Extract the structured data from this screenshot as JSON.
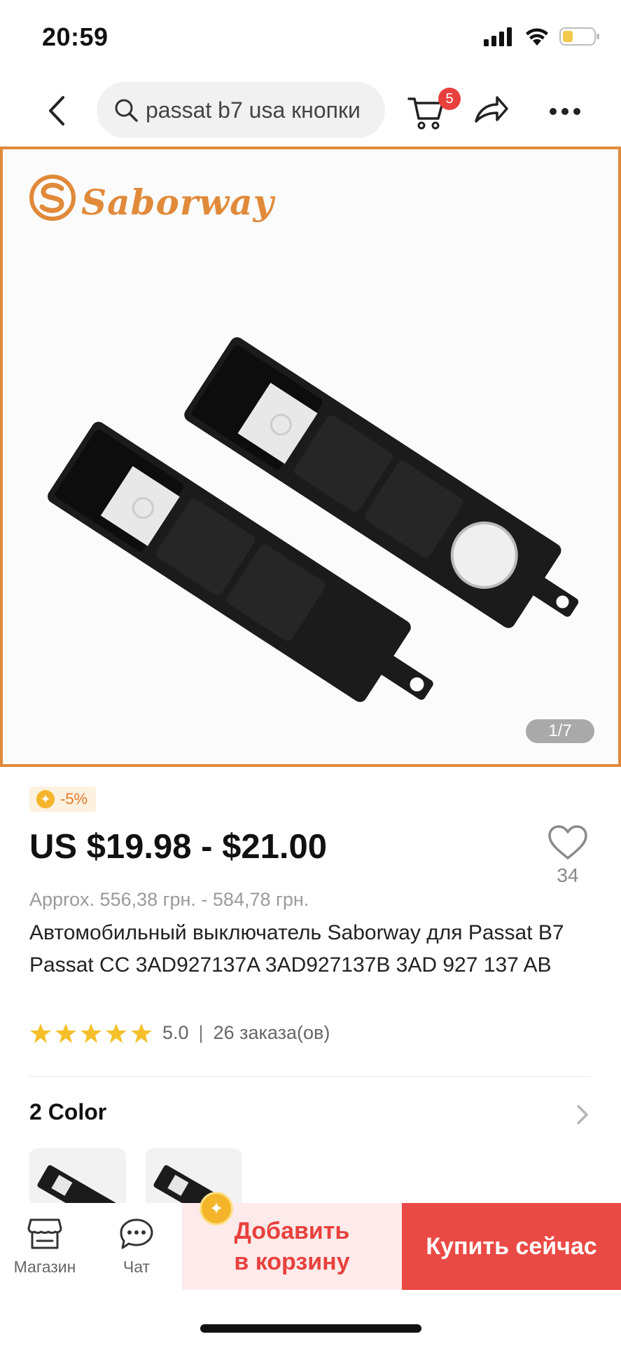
{
  "status_bar": {
    "time": "20:59"
  },
  "header": {
    "search_value": "passat b7 usa кнопки",
    "cart_count": "5"
  },
  "gallery": {
    "brand_logo": "Saborway",
    "counter": "1/7",
    "accent_color": "#e08a3a"
  },
  "product": {
    "discount_badge": "-5%",
    "price": "US $19.98 - $21.00",
    "approx_price": "Approx. 556,38 грн. - 584,78 грн.",
    "title": "Автомобильный выключатель Saborway для Passat B7 Passat CC 3AD927137A 3AD927137B 3AD 927 137 AB",
    "rating_value": "5.0",
    "rating_stars": 5,
    "orders": "26 заказа(ов)",
    "wishlist_count": "34"
  },
  "variants": {
    "title": "2 Color",
    "count": 2
  },
  "bottom_bar": {
    "store_label": "Магазин",
    "chat_label": "Чат",
    "add_to_cart_line1": "Добавить",
    "add_to_cart_line2": "в корзину",
    "buy_now_label": "Купить сейчас",
    "primary_color": "#ea4a45"
  },
  "icons": [
    "back-arrow-icon",
    "search-icon",
    "cart-icon",
    "share-icon",
    "more-icon",
    "heart-icon",
    "star-icon",
    "chevron-right-icon",
    "store-icon",
    "chat-icon",
    "coin-icon"
  ]
}
